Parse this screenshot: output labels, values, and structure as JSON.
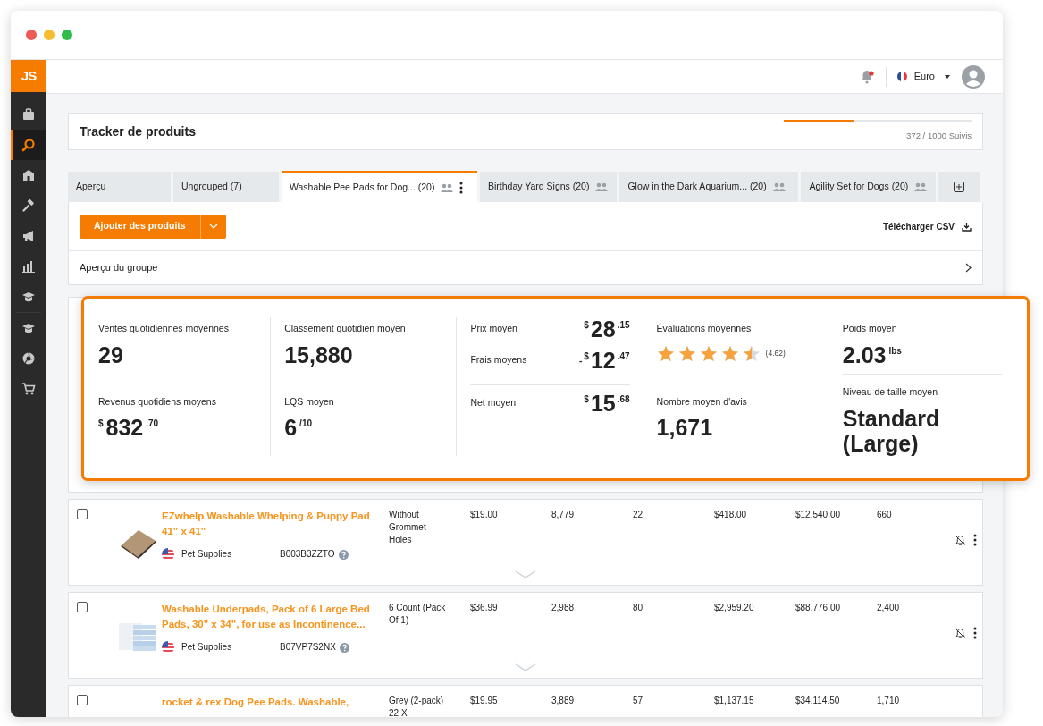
{
  "logo": "JS",
  "sidebar": {
    "items": [
      {
        "selected": false
      },
      {
        "selected": true
      },
      {
        "selected": false
      },
      {
        "selected": false
      },
      {
        "selected": false
      },
      {
        "selected": false
      },
      {
        "selected": false
      },
      {
        "selected": false
      },
      {
        "selected": false
      },
      {
        "selected": false
      }
    ]
  },
  "topbar": {
    "notification_dot": true,
    "currency": "Euro"
  },
  "header": {
    "title": "Tracker de produits",
    "level": 0.372,
    "reading": "372 / 1000 Suivis"
  },
  "tabs": [
    {
      "label": "Aperçu",
      "selected": false
    },
    {
      "label": "Ungrouped (7)",
      "selected": false
    },
    {
      "label": "Washable Pee Pads for Dog... (20)",
      "shared": true,
      "selected": true
    },
    {
      "label": "Birthday Yard Signs (20)",
      "shared": true,
      "selected": false
    },
    {
      "label": "Glow in the Dark Aquarium... (20)",
      "shared": true,
      "selected": false
    },
    {
      "label": "Agility Set for Dogs (20)",
      "shared": true,
      "selected": false
    }
  ],
  "toolbar": {
    "add_button": "Ajouter des produits",
    "download": "Télécharger CSV"
  },
  "group_overview": "Aperçu du groupe",
  "stats_panel": {
    "columns": [
      {
        "groups": [
          [
            {
              "kind": "big",
              "label": "Ventes quotidiennes moyennes",
              "value": "29"
            }
          ],
          [
            {
              "kind": "big",
              "label": "Revenus quotidiens moyens",
              "prefix": "$",
              "value": "832",
              "suffix": ".70"
            }
          ]
        ]
      },
      {
        "groups": [
          [
            {
              "kind": "big",
              "label": "Classement quotidien moyen",
              "value": "15,880"
            }
          ],
          [
            {
              "kind": "big",
              "label": "LQS moyen",
              "value": "6",
              "suffix": "/10"
            }
          ]
        ]
      },
      {
        "groups": [
          [
            {
              "kind": "inline",
              "label": "Prix moyen",
              "prefix": "$",
              "value": "28",
              "suffix": ".15"
            },
            {
              "kind": "inline",
              "label": "Frais moyens",
              "sign": "-",
              "prefix": "$",
              "value": "12",
              "suffix": ".47"
            }
          ],
          [
            {
              "kind": "inline",
              "label": "Net moyen",
              "prefix": "$",
              "value": "15",
              "suffix": ".68"
            }
          ]
        ]
      },
      {
        "groups": [
          [
            {
              "kind": "stars",
              "label": "Évaluations moyennes",
              "stars": 4.5,
              "reading": "(4.62)"
            }
          ],
          [
            {
              "kind": "big",
              "label": "Nombre moyen d'avis",
              "value": "1,671"
            }
          ]
        ]
      },
      {
        "groups": [
          [
            {
              "kind": "big",
              "label": "Poids moyen",
              "value": "2.03",
              "suffix": "lbs"
            }
          ],
          [
            {
              "kind": "big",
              "label": "Niveau de taille moyen",
              "value": "Standard (Large)"
            }
          ]
        ]
      }
    ]
  },
  "rows": [
    {
      "checked": false,
      "title": "EZwhelp Washable Whelping & Puppy Pad 41\" x 41\"",
      "category": "Pet Supplies",
      "asin": "B003B3ZZTO",
      "variant": "Without Grommet Holes",
      "values": [
        "$19.00",
        "8,779",
        "22",
        "$418.00",
        "$12,540.00",
        "660"
      ]
    },
    {
      "checked": false,
      "title": "Washable Underpads, Pack of 6 Large Bed Pads, 30\" x 34\", for use as Incontinence...",
      "category": "Pet Supplies",
      "asin": "B07VP7S2NX",
      "variant": "6 Count (Pack Of 1)",
      "values": [
        "$36.99",
        "2,988",
        "80",
        "$2,959.20",
        "$88,776.00",
        "2,400"
      ]
    },
    {
      "checked": false,
      "title": "rocket & rex Dog Pee Pads. Washable,",
      "variant": "Grey (2-pack) 22 X",
      "values": [
        "$19.95",
        "3,889",
        "57",
        "$1,137.15",
        "$34,114.50",
        "1,710"
      ]
    }
  ]
}
